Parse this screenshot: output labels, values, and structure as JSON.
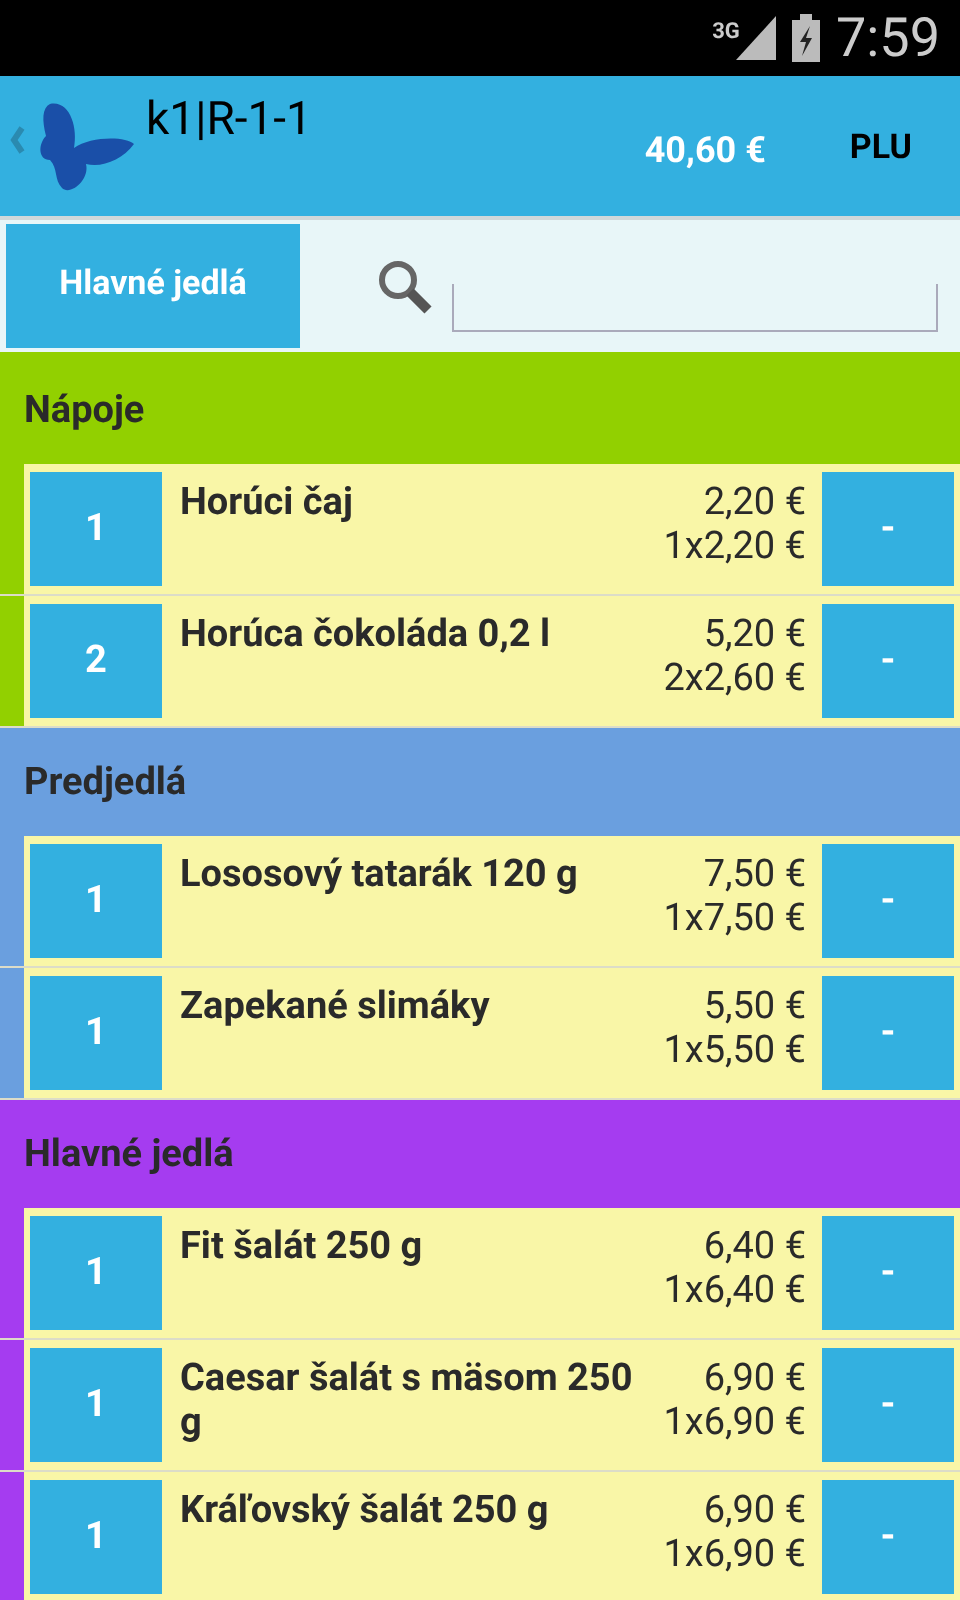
{
  "status_bar": {
    "network": "3G",
    "time": "7:59"
  },
  "header": {
    "title": "k1|R-1-1",
    "total": "40,60 €",
    "plu_button": "PLU"
  },
  "filter": {
    "category_button": "Hlavné jedlá"
  },
  "categories": [
    {
      "name": "Nápoje",
      "color": "#92d000",
      "items": [
        {
          "qty": "1",
          "name": "Horúci čaj",
          "total": "2,20 €",
          "unit": "1x2,20 €",
          "minus": "-"
        },
        {
          "qty": "2",
          "name": "Horúca čokoláda 0,2 l",
          "total": "5,20 €",
          "unit": "2x2,60 €",
          "minus": "-"
        }
      ]
    },
    {
      "name": "Predjedlá",
      "color": "#6a9fdf",
      "items": [
        {
          "qty": "1",
          "name": "Lososový tatarák 120 g",
          "total": "7,50 €",
          "unit": "1x7,50 €",
          "minus": "-"
        },
        {
          "qty": "1",
          "name": "Zapekané slimáky",
          "total": "5,50 €",
          "unit": "1x5,50 €",
          "minus": "-"
        }
      ]
    },
    {
      "name": "Hlavné jedlá",
      "color": "#a53cf0",
      "items": [
        {
          "qty": "1",
          "name": "Fit šalát 250 g",
          "total": "6,40 €",
          "unit": "1x6,40 €",
          "minus": "-"
        },
        {
          "qty": "1",
          "name": "Caesar šalát s mäsom 250 g",
          "total": "6,90 €",
          "unit": "1x6,90 €",
          "minus": "-"
        },
        {
          "qty": "1",
          "name": "Kráľovský šalát 250 g",
          "total": "6,90 €",
          "unit": "1x6,90 €",
          "minus": "-"
        }
      ]
    }
  ]
}
